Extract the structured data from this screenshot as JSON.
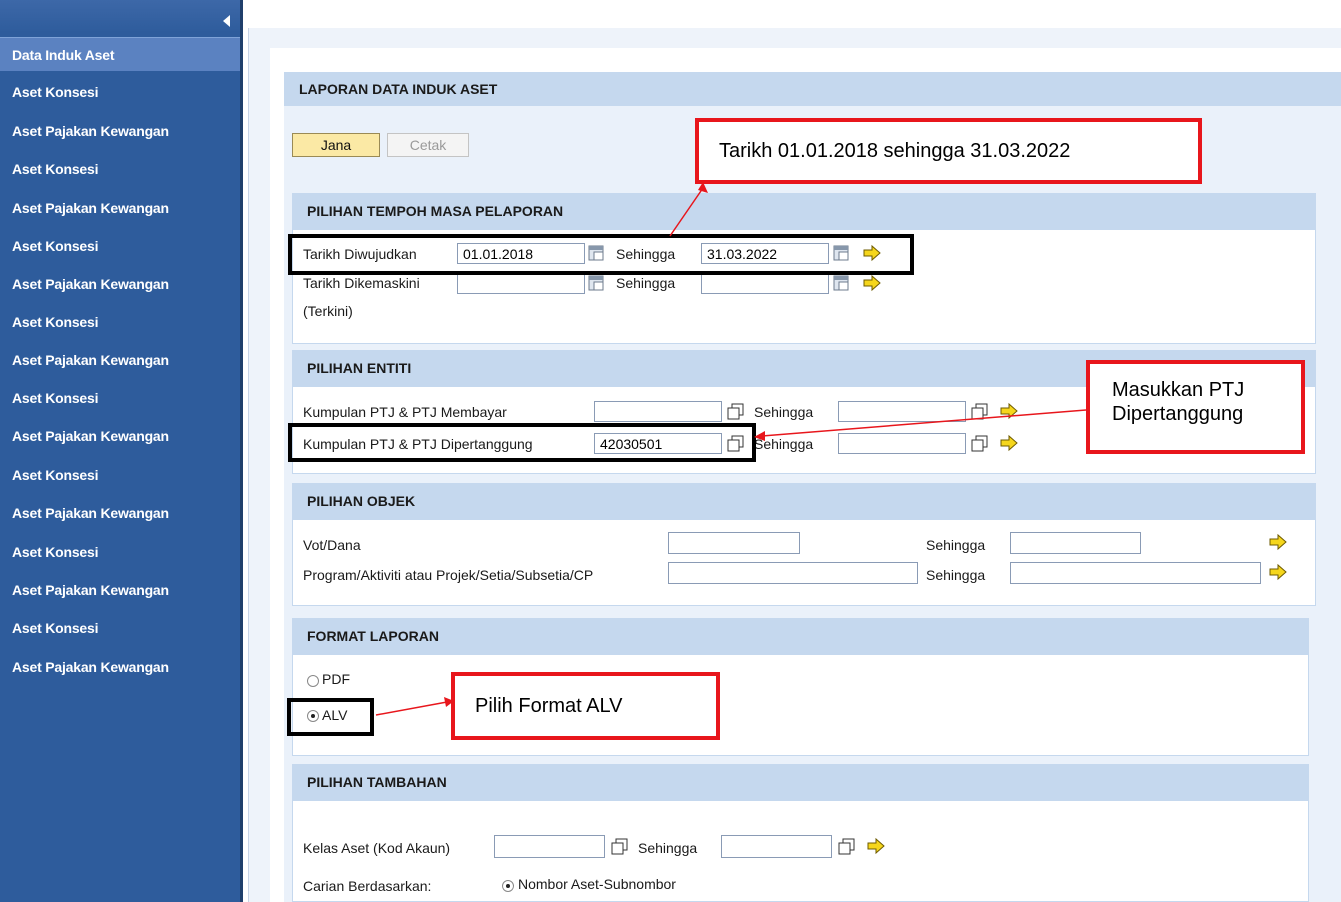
{
  "sidebar": {
    "items": [
      {
        "label": "Data Induk Aset"
      },
      {
        "label": "Aset Konsesi"
      },
      {
        "label": "Aset Pajakan Kewangan"
      },
      {
        "label": "Aset Konsesi"
      },
      {
        "label": "Aset Pajakan Kewangan"
      },
      {
        "label": "Aset Konsesi"
      },
      {
        "label": "Aset Pajakan Kewangan"
      },
      {
        "label": "Aset Konsesi"
      },
      {
        "label": "Aset Pajakan Kewangan"
      },
      {
        "label": "Aset Konsesi"
      },
      {
        "label": "Aset Pajakan Kewangan"
      },
      {
        "label": "Aset Konsesi"
      },
      {
        "label": "Aset Pajakan Kewangan"
      },
      {
        "label": "Aset Konsesi"
      },
      {
        "label": "Aset Pajakan Kewangan"
      },
      {
        "label": "Aset Konsesi"
      },
      {
        "label": "Aset Pajakan Kewangan"
      }
    ]
  },
  "report": {
    "title": "LAPORAN DATA INDUK ASET",
    "jana_label": "Jana",
    "cetak_label": "Cetak"
  },
  "tempoh": {
    "header": "PILIHAN TEMPOH MASA PELAPORAN",
    "created_label": "Tarikh Diwujudkan",
    "created_from": "01.01.2018",
    "until_label": "Sehingga",
    "created_to": "31.03.2022",
    "updated_label": "Tarikh Dikemaskini",
    "updated_label2": "(Terkini)",
    "updated_from": "",
    "updated_to": ""
  },
  "entiti": {
    "header": "PILIHAN ENTITI",
    "paying_label": "Kumpulan PTJ & PTJ Membayar",
    "paying_from": "",
    "paying_to": "",
    "charged_label": "Kumpulan PTJ & PTJ Dipertanggung",
    "charged_from": "42030501",
    "charged_to": "",
    "until_label": "Sehingga"
  },
  "objek": {
    "header": "PILIHAN OBJEK",
    "vot_label": "Vot/Dana",
    "program_label": "Program/Aktiviti atau Projek/Setia/Subsetia/CP",
    "until_label": "Sehingga",
    "vot_from": "",
    "vot_to": "",
    "program_from": "",
    "program_to": ""
  },
  "format": {
    "header": "FORMAT LAPORAN",
    "pdf_label": "PDF",
    "alv_label": "ALV",
    "selected": "ALV"
  },
  "tambahan": {
    "header": "PILIHAN TAMBAHAN",
    "kelas_label": "Kelas Aset (Kod Akaun)",
    "until_label": "Sehingga",
    "kelas_from": "",
    "kelas_to": "",
    "carian_label": "Carian Berdasarkan:",
    "carian_option": "Nombor Aset-Subnombor"
  },
  "annotations": {
    "date_note": "Tarikh 01.01.2018 sehingga  31.03.2022",
    "ptj_note_line1": "Masukkan PTJ",
    "ptj_note_line2": "Dipertanggung",
    "format_note": "Pilih Format ALV"
  },
  "colors": {
    "sidebar_bg": "#2e5c9c",
    "section_header": "#c5d8ee",
    "callout_border": "#e8161c",
    "highlight_border": "#000000",
    "jana_bg": "#fbe9a5"
  }
}
